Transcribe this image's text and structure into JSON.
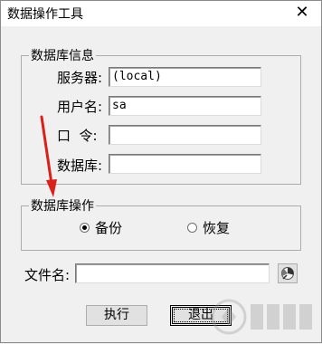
{
  "window": {
    "title": "数据操作工具",
    "close_glyph": "✕"
  },
  "db_info": {
    "legend": "数据库信息",
    "server": {
      "label": "服务器:",
      "value": "(local)"
    },
    "username": {
      "label": "用户名:",
      "value": "sa"
    },
    "password": {
      "label": "口  令:",
      "value": ""
    },
    "database": {
      "label": "数据库:",
      "value": ""
    }
  },
  "db_ops": {
    "legend": "数据库操作",
    "options": [
      {
        "label": "备份",
        "selected": true
      },
      {
        "label": "恢复",
        "selected": false
      }
    ]
  },
  "file": {
    "label": "文件名:",
    "value": "",
    "browse_icon": "browse-icon"
  },
  "buttons": {
    "execute": "执行",
    "exit": "退出"
  },
  "annotation": {
    "arrow_color": "#d9201a"
  }
}
